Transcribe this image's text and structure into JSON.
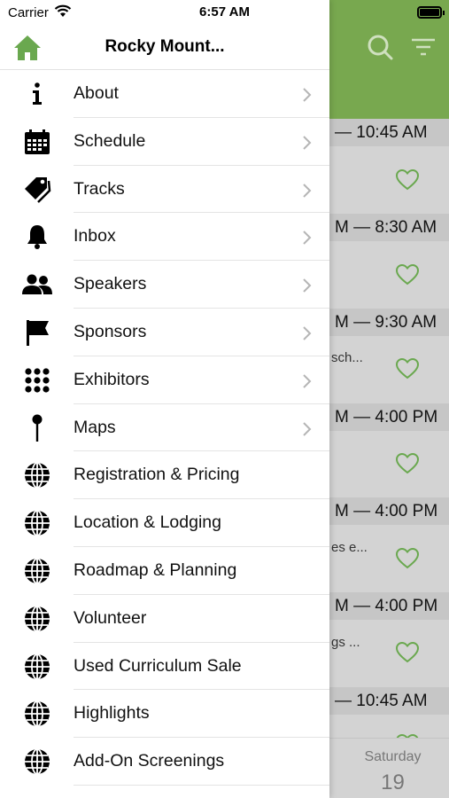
{
  "status_bar": {
    "carrier": "Carrier",
    "time": "6:57 AM"
  },
  "drawer": {
    "title": "Rocky Mount...",
    "items": [
      {
        "label": "About",
        "icon": "info-icon",
        "chevron": true
      },
      {
        "label": "Schedule",
        "icon": "calendar-icon",
        "chevron": true
      },
      {
        "label": "Tracks",
        "icon": "tags-icon",
        "chevron": true
      },
      {
        "label": "Inbox",
        "icon": "bell-icon",
        "chevron": true
      },
      {
        "label": "Speakers",
        "icon": "people-icon",
        "chevron": true
      },
      {
        "label": "Sponsors",
        "icon": "flag-icon",
        "chevron": true
      },
      {
        "label": "Exhibitors",
        "icon": "grid-dots-icon",
        "chevron": true
      },
      {
        "label": "Maps",
        "icon": "map-pin-icon",
        "chevron": true
      },
      {
        "label": "Registration & Pricing",
        "icon": "globe-icon",
        "chevron": false
      },
      {
        "label": "Location & Lodging",
        "icon": "globe-icon",
        "chevron": false
      },
      {
        "label": "Roadmap & Planning",
        "icon": "globe-icon",
        "chevron": false
      },
      {
        "label": "Volunteer",
        "icon": "globe-icon",
        "chevron": false
      },
      {
        "label": "Used Curriculum Sale",
        "icon": "globe-icon",
        "chevron": false
      },
      {
        "label": "Highlights",
        "icon": "globe-icon",
        "chevron": false
      },
      {
        "label": "Add-On Screenings",
        "icon": "globe-icon",
        "chevron": false
      }
    ]
  },
  "background_schedule": {
    "rows": [
      {
        "time": "— 10:45 AM",
        "sub": ""
      },
      {
        "time": "M — 8:30 AM",
        "sub": ""
      },
      {
        "time": "M — 9:30 AM",
        "sub": "sch..."
      },
      {
        "time": "M — 4:00 PM",
        "sub": ""
      },
      {
        "time": "M — 4:00 PM",
        "sub": "es e..."
      },
      {
        "time": "M — 4:00 PM",
        "sub": "gs ..."
      },
      {
        "time": "— 10:45 AM",
        "sub": ""
      }
    ],
    "tab_day": "Saturday",
    "tab_date": "19"
  },
  "colors": {
    "accent": "#78a84f",
    "heart": "#6aa84f"
  }
}
